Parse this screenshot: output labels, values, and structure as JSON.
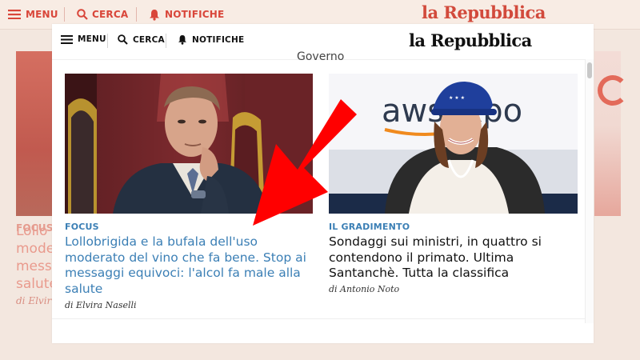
{
  "bg_header": {
    "menu_label": "MENU",
    "search_label": "CERCA",
    "notifications_label": "NOTIFICHE",
    "logo": "la Repubblica"
  },
  "bg_article": {
    "tag": "FOCUS",
    "title_lines": [
      "Lollo",
      "mode",
      "messa",
      "salute"
    ],
    "author": "di Elvir"
  },
  "header": {
    "menu_label": "MENU",
    "search_label": "CERCA",
    "notifications_label": "NOTIFICHE",
    "logo": "la Repubblica",
    "section_peek": "Governo"
  },
  "articles": [
    {
      "tag": "FOCUS",
      "title": "Lollobrigida e la bufala dell'uso moderato del vino che fa bene. Stop ai messaggi equivoci: l'alcol fa male alla salute",
      "author": "di Elvira Naselli",
      "image_alt": "Uomo in giacca seduto in aula parlamentare con la testa appoggiata alla mano"
    },
    {
      "tag": "IL GRADIMENTO",
      "title": "Sondaggi sui ministri, in quattro si contendono il primato. Ultima Santanchè. Tutta la classifica",
      "author": "di Antonio Noto",
      "image_alt": "Donna con cappellino blu sorridente davanti a un pannello"
    }
  ],
  "image2_sign_text": "awsaxpo",
  "colors": {
    "accent_red": "#d9463a",
    "link_blue": "#3b7fb5",
    "arrow_red": "#ff0000"
  },
  "icons": {
    "menu": "hamburger-icon",
    "search": "search-icon",
    "notifications": "bell-icon",
    "annotation": "arrow-icon"
  }
}
